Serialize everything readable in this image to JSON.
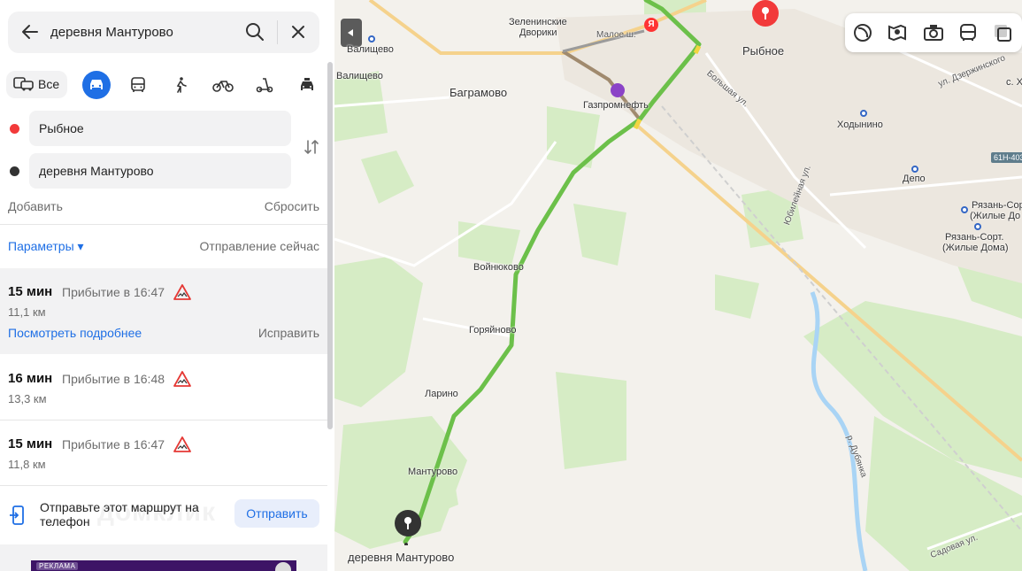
{
  "search": {
    "query": "деревня Мантурово"
  },
  "modes": {
    "all_label": "Все"
  },
  "route_points": {
    "from": "Рыбное",
    "to": "деревня Мантурово"
  },
  "actions": {
    "add": "Добавить",
    "reset": "Сбросить"
  },
  "params": {
    "label": "Параметры ▾",
    "departure": "Отправление сейчас"
  },
  "routes": [
    {
      "time": "15 мин",
      "arrival": "Прибытие в 16:47",
      "distance": "11,1 км",
      "details": "Посмотреть подробнее",
      "fix": "Исправить"
    },
    {
      "time": "16 мин",
      "arrival": "Прибытие в 16:48",
      "distance": "13,3 км"
    },
    {
      "time": "15 мин",
      "arrival": "Прибытие в 16:47",
      "distance": "11,8 км"
    }
  ],
  "send": {
    "text": "Отправьте этот маршрут на телефон",
    "button": "Отправить"
  },
  "ad": {
    "label": "РЕКЛАМА"
  },
  "watermark": "домклик",
  "map": {
    "labels": {
      "zelen": "Зеленинские",
      "zelen2": "Дворики",
      "valishevo_stop": "Валищево",
      "valishevo": "Валищево",
      "bagramovo": "Баграмово",
      "gazprom": "Газпромнефть",
      "malaya": "Малое ш.",
      "rybnoe": "Рыбное",
      "bolshaya": "Большая ул.",
      "dzerzh": "ул. Дзержинского",
      "s_kh": "с. Х",
      "khodynino": "Ходынино",
      "depo": "Депо",
      "yubil": "Юбилейная ул.",
      "ryazan1": "Рязань-Сор",
      "ryazan1b": "(Жилые До",
      "ryazan2": "Рязань-Сорт.",
      "ryazan2b": "(Жилые Дома)",
      "voinyukovo": "Войнюково",
      "goryainovo": "Горяйново",
      "larino": "Ларино",
      "manturovo": "Мантурово",
      "dest": "деревня Мантурово",
      "river": "р. Дубянка",
      "sadovaya": "Садовая ул.",
      "road_badge": "61Н-403"
    }
  },
  "colors": {
    "accent": "#1f6fe5",
    "route": "#6cc04a",
    "start": "#f23a3a",
    "end": "#333333"
  }
}
